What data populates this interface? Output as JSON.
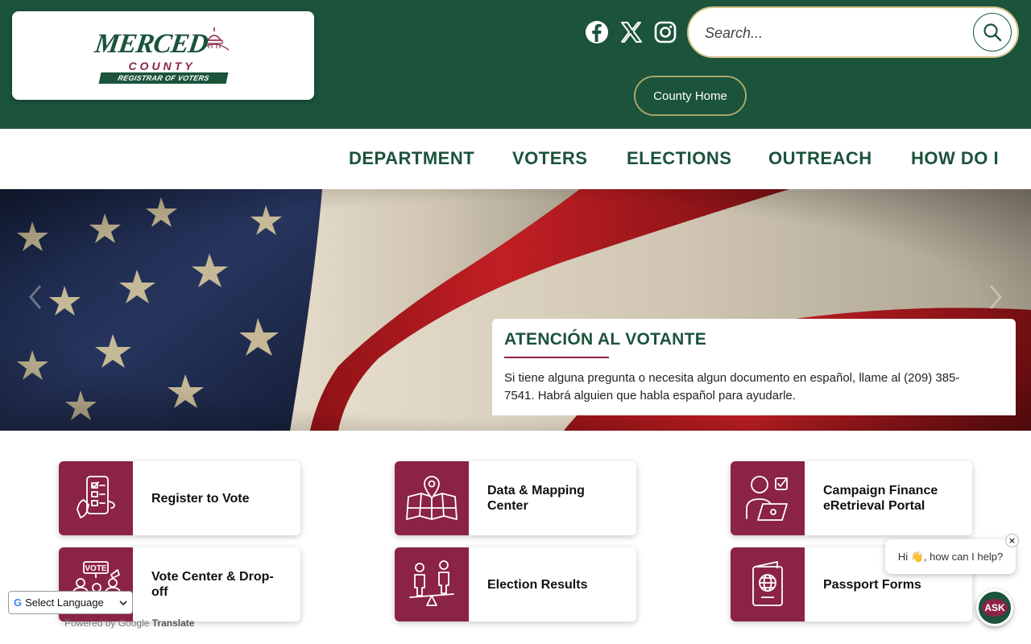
{
  "header": {
    "logo": {
      "line1": "MERCED",
      "line2": "COUNTY",
      "line3": "REGISTRAR OF VOTERS"
    },
    "social": [
      "facebook-icon",
      "x-icon",
      "instagram-icon"
    ],
    "search": {
      "placeholder": "Search..."
    },
    "county_home_label": "County Home",
    "colors": {
      "primary": "#1b533b",
      "accent": "#8b2345",
      "gold": "#d4c28a"
    }
  },
  "nav": {
    "items": [
      "DEPARTMENT",
      "VOTERS",
      "ELECTIONS",
      "OUTREACH",
      "HOW DO I"
    ]
  },
  "hero": {
    "title": "ATENCIÓN AL VOTANTE",
    "text": "Si tiene alguna pregunta o necesita algun documento en español, llame al (209) 385-7541. Habrá alguien que habla español para ayudarle."
  },
  "quick_links": [
    {
      "label": "Register to Vote",
      "icon": "phone-checklist-icon"
    },
    {
      "label": "Data & Mapping Center",
      "icon": "map-pin-icon"
    },
    {
      "label": "Campaign Finance eRetrieval Portal",
      "icon": "person-laptop-icon"
    },
    {
      "label": "Vote Center & Drop-off",
      "icon": "vote-people-icon"
    },
    {
      "label": "Election Results",
      "icon": "scale-people-icon"
    },
    {
      "label": "Passport Forms",
      "icon": "passport-icon"
    }
  ],
  "translate": {
    "label": "Select Language",
    "powered_by": "Powered by",
    "google": "Google",
    "translate": "Translate"
  },
  "chat": {
    "greeting": "Hi 👋, how can I help?",
    "close": "×",
    "ask_label": "ASK"
  }
}
